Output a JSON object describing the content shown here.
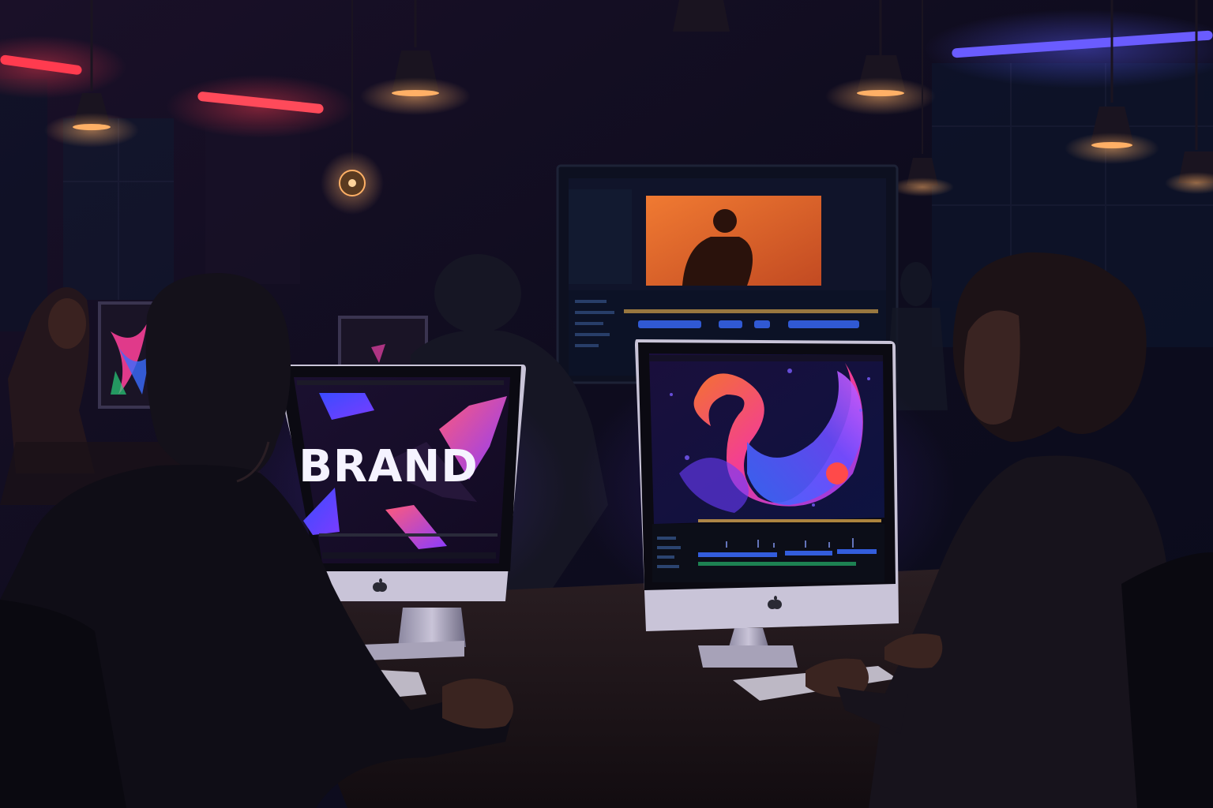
{
  "scene": {
    "description_free": true,
    "left_monitor": {
      "headline": "BRAND"
    },
    "colors": {
      "neon_red": "#ff3b4f",
      "neon_blue": "#5a5cff",
      "lamp_warm": "#ffb066",
      "screen_orange": "#e5622a",
      "accent_purple": "#8a3cff",
      "accent_magenta": "#d23c9a",
      "accent_blue": "#2f6bff"
    },
    "icons": [
      "apple-logo-icon",
      "pendant-lamp-icon",
      "edison-bulb-icon"
    ]
  }
}
